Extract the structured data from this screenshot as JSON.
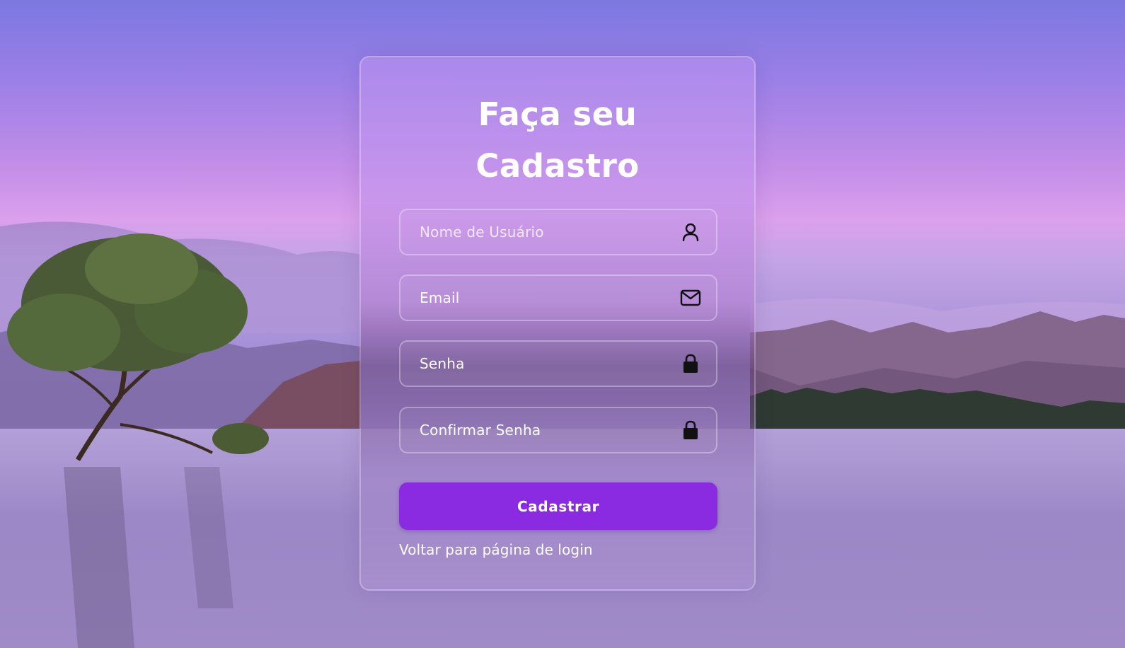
{
  "form": {
    "title_line1": "Faça seu",
    "title_line2": "Cadastro",
    "fields": [
      {
        "placeholder": "Nome de Usuário",
        "icon": "user-icon"
      },
      {
        "placeholder": "Email",
        "icon": "envelope-icon"
      },
      {
        "placeholder": "Senha",
        "icon": "lock-icon"
      },
      {
        "placeholder": "Confirmar Senha",
        "icon": "lock-icon"
      }
    ],
    "submit_label": "Cadastrar",
    "back_link": "Voltar para página de login"
  },
  "colors": {
    "accent": "#8a2be2",
    "text": "#ffffff",
    "icon": "#111111"
  }
}
